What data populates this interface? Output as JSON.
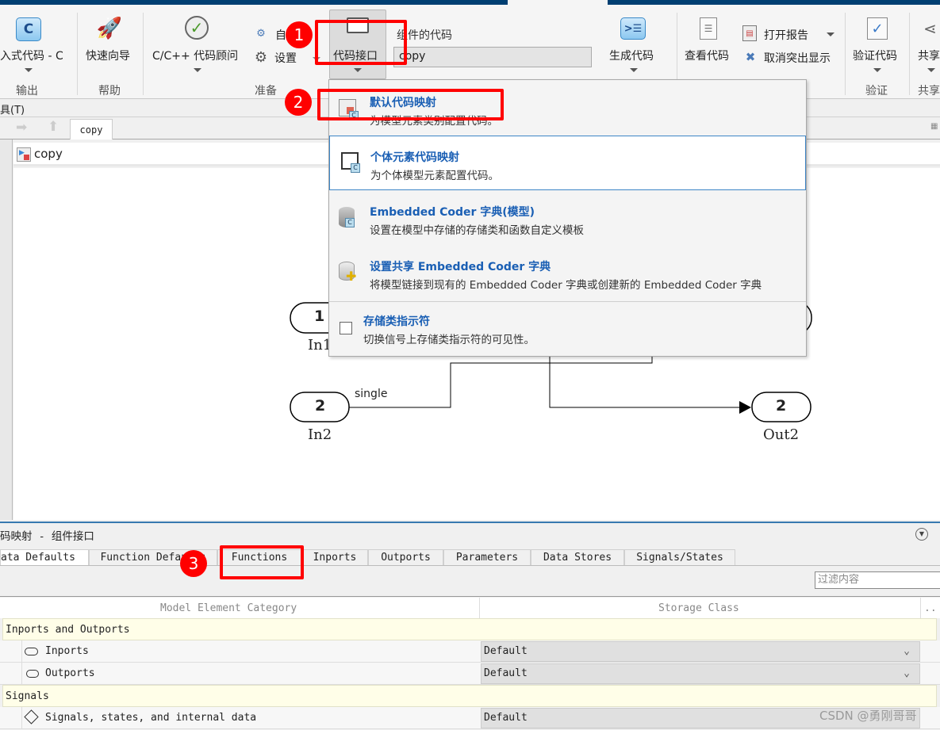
{
  "ribbon": {
    "embedded_code": "入式代码 - C",
    "quick_guide": "快速向导",
    "cpp_advisor": "C/C++ 代码顾问",
    "auto": "自",
    "settings": "设置",
    "code_interface": "代码接口",
    "component_code_label": "组件的代码",
    "component_code_value": "copy",
    "generate_code": "生成代码",
    "view_code": "查看代码",
    "open_report": "打开报告",
    "remove_highlight": "取消突出显示",
    "verify_code": "验证代码",
    "share": "共享",
    "groups": {
      "output": "输出",
      "help": "帮助",
      "prepare": "准备",
      "verify": "验证",
      "share": "共享"
    }
  },
  "menubar": {
    "tools": "具(T)"
  },
  "tabbar": {
    "model_tab": "copy"
  },
  "breadcrumb": {
    "model": "copy"
  },
  "dropdown": {
    "items": [
      {
        "title": "默认代码映射",
        "desc": "为模型元素类别配置代码。"
      },
      {
        "title": "个体元素代码映射",
        "desc": "为个体模型元素配置代码。"
      },
      {
        "title": "Embedded Coder 字典(模型)",
        "desc": "设置在模型中存储的存储类和函数自定义模板"
      },
      {
        "title": "设置共享 Embedded Coder 字典",
        "desc": "将模型链接到现有的 Embedded Coder 字典或创建新的 Embedded Coder 字典"
      },
      {
        "title": "存储类指示符",
        "desc": "切换信号上存储类指示符的可见性。",
        "checked": false
      }
    ]
  },
  "diagram": {
    "in1": {
      "number": "1",
      "name": "In1"
    },
    "in2": {
      "number": "2",
      "name": "In2"
    },
    "out2": {
      "number": "2",
      "name": "Out2"
    },
    "signal_label": "single"
  },
  "annotations": {
    "step1": "1",
    "step2": "2",
    "step3": "3"
  },
  "panel": {
    "title": "码映射 - 组件接口",
    "tabs": [
      "ata Defaults",
      "Function Defaults",
      "Functions",
      "Inports",
      "Outports",
      "Parameters",
      "Data Stores",
      "Signals/States"
    ],
    "filter_placeholder": "过滤内容",
    "columns": [
      "Model Element Category",
      "Storage Class",
      ".."
    ],
    "rows": [
      {
        "type": "group",
        "label": "Inports and Outports"
      },
      {
        "type": "item",
        "label": "Inports",
        "storage": "Default"
      },
      {
        "type": "item",
        "label": "Outports",
        "storage": "Default"
      },
      {
        "type": "group",
        "label": "Signals"
      },
      {
        "type": "item",
        "label": "Signals, states, and internal data",
        "storage": "Default"
      }
    ]
  },
  "watermark": "CSDN @勇刚哥哥",
  "colors": {
    "highlight": "#ff0000",
    "link": "#1a5fb4",
    "top_bar": "#003f72",
    "group_row": "#fffee8"
  }
}
